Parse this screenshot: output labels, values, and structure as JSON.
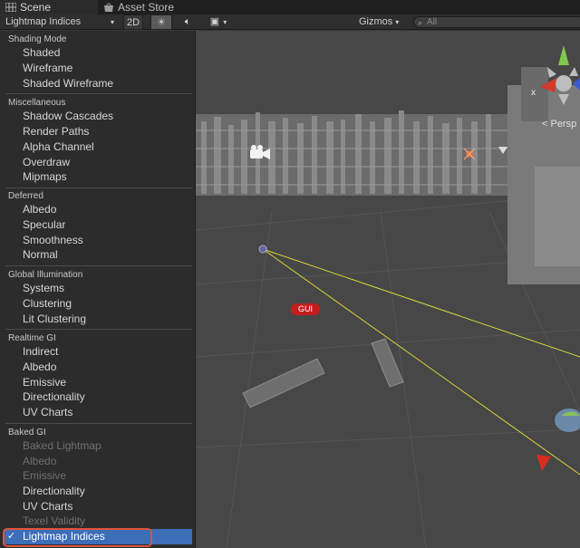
{
  "tabs": {
    "scene": "Scene",
    "asset_store": "Asset Store"
  },
  "toolbar": {
    "draw_mode": "Lightmap Indices",
    "btn_2d": "2D",
    "light_icon": "sun-icon",
    "audio_icon": "speaker-icon",
    "fx_icon": "image-icon",
    "gizmos": "Gizmos",
    "search_placeholder": "All"
  },
  "viewport": {
    "persp_label": "< Persp",
    "gui_tag": "GUI",
    "gizmo_axis_x": "x"
  },
  "menu": {
    "sections": {
      "shading": {
        "header": "Shading Mode",
        "items": [
          "Shaded",
          "Wireframe",
          "Shaded Wireframe"
        ]
      },
      "misc": {
        "header": "Miscellaneous",
        "items": [
          "Shadow Cascades",
          "Render Paths",
          "Alpha Channel",
          "Overdraw",
          "Mipmaps"
        ]
      },
      "deferred": {
        "header": "Deferred",
        "items": [
          "Albedo",
          "Specular",
          "Smoothness",
          "Normal"
        ]
      },
      "gi": {
        "header": "Global Illumination",
        "items": [
          "Systems",
          "Clustering",
          "Lit Clustering"
        ]
      },
      "realtime": {
        "header": "Realtime GI",
        "items": [
          "Indirect",
          "Albedo",
          "Emissive",
          "Directionality",
          "UV Charts"
        ]
      },
      "baked": {
        "header": "Baked GI",
        "items": [
          "Baked Lightmap",
          "Albedo",
          "Emissive",
          "Directionality",
          "UV Charts",
          "Texel Validity",
          "Lightmap Indices"
        ]
      }
    },
    "selected_check": "✓"
  },
  "colors": {
    "accent_selected": "#3d6eb8",
    "highlight_ring": "#e0533a",
    "gui_red": "#c41d1d"
  }
}
